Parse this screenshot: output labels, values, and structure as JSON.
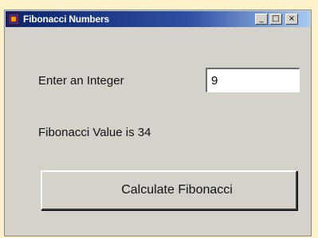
{
  "window": {
    "title": "Fibonacci Numbers",
    "controls": {
      "minimize": "_",
      "maximize": "□",
      "close": "×"
    }
  },
  "form": {
    "input_label": "Enter an Integer",
    "input_value": "9",
    "result_text": "Fibonacci Value is 34",
    "button_label": "Calculate Fibonacci"
  }
}
